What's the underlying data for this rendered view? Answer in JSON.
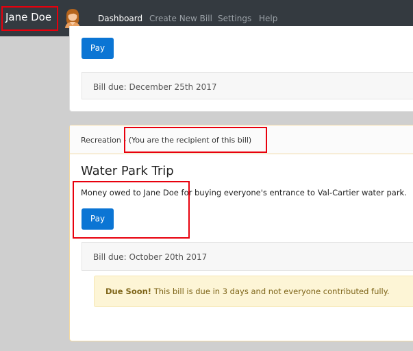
{
  "navbar": {
    "user_name": "Jane Doe",
    "links": [
      "Dashboard",
      "Create New Bill",
      "Settings",
      "Help"
    ]
  },
  "bills": [
    {
      "pay_label": "Pay",
      "due": "Bill due: December 25th 2017"
    },
    {
      "category": "Recreation",
      "recipient_note": " - (You are the recipient of this bill)",
      "title": "Water Park Trip",
      "description": "Money owed to Jane Doe for buying everyone's entrance to Val-Cartier water park.",
      "pay_label": "Pay",
      "due": "Bill due: October 20th 2017",
      "alert_strong": "Due Soon!",
      "alert_text": " This bill is due in 3 days and not everyone contributed fully."
    }
  ],
  "colors": {
    "navbar": "#343a40",
    "primary": "#0b75d4",
    "highlight": "#e8000d",
    "warning_bg": "#fdf5d6"
  }
}
